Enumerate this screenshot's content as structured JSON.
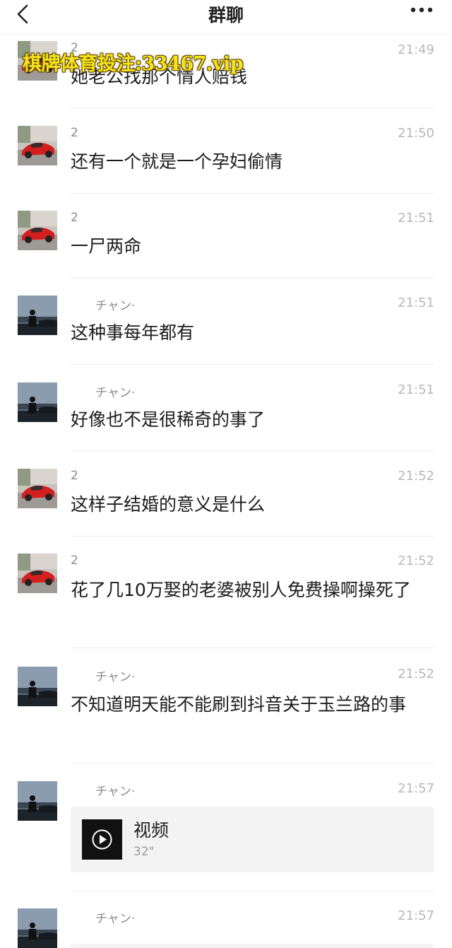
{
  "header": {
    "title": "群聊"
  },
  "watermark": "棋牌体育投注:33467.vip",
  "messages": [
    {
      "avatar": "red-car",
      "name": "2",
      "time": "21:49",
      "text": "她老公找那个情人赔钱"
    },
    {
      "avatar": "red-car",
      "name": "2",
      "time": "21:50",
      "text": "还有一个就是一个孕妇偷情"
    },
    {
      "avatar": "red-car",
      "name": "2",
      "time": "21:51",
      "text": "一尸两命"
    },
    {
      "avatar": "night-man",
      "name": "チャン·",
      "time": "21:51",
      "text": "这种事每年都有"
    },
    {
      "avatar": "night-man",
      "name": "チャン·",
      "time": "21:51",
      "text": "好像也不是很稀奇的事了"
    },
    {
      "avatar": "red-car",
      "name": "2",
      "time": "21:52",
      "text": "这样子结婚的意义是什么"
    },
    {
      "avatar": "red-car",
      "name": "2",
      "time": "21:52",
      "text": "花了几10万娶的老婆被别人免费操啊操死了"
    },
    {
      "avatar": "night-man",
      "name": "チャン·",
      "time": "21:52",
      "text": "不知道明天能不能刷到抖音关于玉兰路的事"
    },
    {
      "avatar": "night-man",
      "name": "チャン·",
      "time": "21:57",
      "video": {
        "title": "视频",
        "duration": "32\""
      }
    },
    {
      "avatar": "night-man",
      "name": "チャン·",
      "time": "21:57"
    }
  ]
}
